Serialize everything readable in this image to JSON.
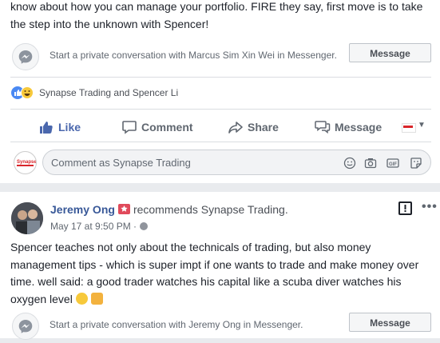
{
  "post1": {
    "text_lines": [
      "know about how you can manage your portfolio. FIRE they say, first move is to take",
      "the step into the unknown with Spencer!"
    ],
    "messenger_prompt": "Start a private conversation with Marcus Sim Xin Wei in Messenger.",
    "message_button": "Message",
    "reactions_names": "Synapse Trading and Spencer Li",
    "actions": {
      "like": "Like",
      "comment": "Comment",
      "share": "Share",
      "message": "Message"
    },
    "comment_placeholder": "Comment as Synapse Trading"
  },
  "post2": {
    "author": "Jeremy Ong",
    "recommend_text": "recommends Synapse Trading.",
    "date": "May 17 at 9:50 PM ·",
    "text": "Spencer teaches not only about the technicals of trading, but also money management tips - which is super impt if one wants to trade and make money over time. well said: a good trader watches his capital like a scuba diver watches his oxygen level",
    "messenger_prompt": "Start a private conversation with Jeremy Ong in Messenger.",
    "message_button": "Message"
  },
  "colors": {
    "link": "#385898",
    "like_active": "#4a67ad",
    "page_bg": "#e9ebee",
    "badge": "#e04a5b"
  }
}
